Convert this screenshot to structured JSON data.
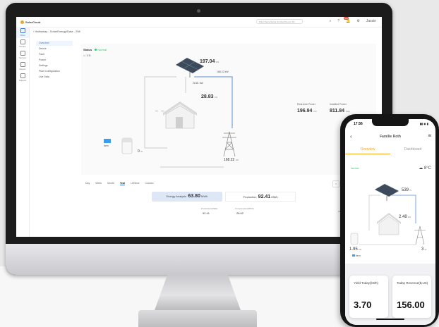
{
  "desktop": {
    "app_name": "SolarCloud",
    "search_placeholder": "Plant Name/Serial Number/Device SN",
    "notification_count": "99+",
    "user": "Jassin",
    "breadcrumb": "Hathaway - Solar/Energy/Data - 298",
    "nav": [
      {
        "label": "Plant"
      },
      {
        "label": "Device"
      },
      {
        "label": "Service"
      },
      {
        "label": "Report"
      },
      {
        "label": "Support"
      }
    ],
    "submenu": [
      "Overview",
      "Device",
      "Fault",
      "Power",
      "Settings",
      "Plant Configuration",
      "Live Data"
    ],
    "status_label": "Status",
    "status_value": "Normal",
    "date": "1/11",
    "flow": {
      "pv_value": "197.04",
      "pv_unit": "kW",
      "pv_sub": "168.22 kW",
      "home_sub": "28.81 kW",
      "load_value": "28.83",
      "load_unit": "kW",
      "battery_value": "0",
      "battery_unit": "W",
      "grid_value": "168.22",
      "grid_unit": "kW",
      "device_label": "Item"
    },
    "realtime_power_label": "Real-time Power",
    "realtime_power_value": "196.94",
    "realtime_power_unit": "kW",
    "installed_power_label": "Installed Power",
    "installed_power_value": "811.84",
    "installed_power_unit": "kWp",
    "tabs": [
      "Day",
      "Week",
      "Month",
      "Year",
      "Lifetime",
      "Custom"
    ],
    "active_tab": "Year",
    "energy_analysis_label": "Energy Analysis",
    "energy_analysis_value": "63.80",
    "energy_analysis_unit": "MWh",
    "production_label": "Production",
    "production_value": "92.41",
    "production_unit": "MWh",
    "sub1_label": "Production(MWh)",
    "sub1_value": "92.41",
    "sub2_label": "Consumption(MWh)",
    "sub2_value": "28.62",
    "page_prev": "<",
    "page_label": "2024"
  },
  "phone": {
    "time": "17:56",
    "status_icons": "▮▮ ◉ ▮",
    "title": "Familie Roth",
    "tabs": [
      "Overview",
      "Dashboard"
    ],
    "status_value": "Normal",
    "weather": "8°C",
    "pv_value": "539",
    "pv_unit": "W",
    "load_value": "2.48",
    "load_unit": "kW",
    "battery_value": "1.95",
    "battery_unit": "kW",
    "grid_value": "3",
    "grid_unit": "W",
    "line_label_1": "",
    "line_label_2": "",
    "device_label": "Item",
    "card1_label": "Yield Today(kWh)",
    "card1_value": "3.70",
    "card2_label": "Today Revenue($,US)",
    "card2_value": "156.00"
  }
}
